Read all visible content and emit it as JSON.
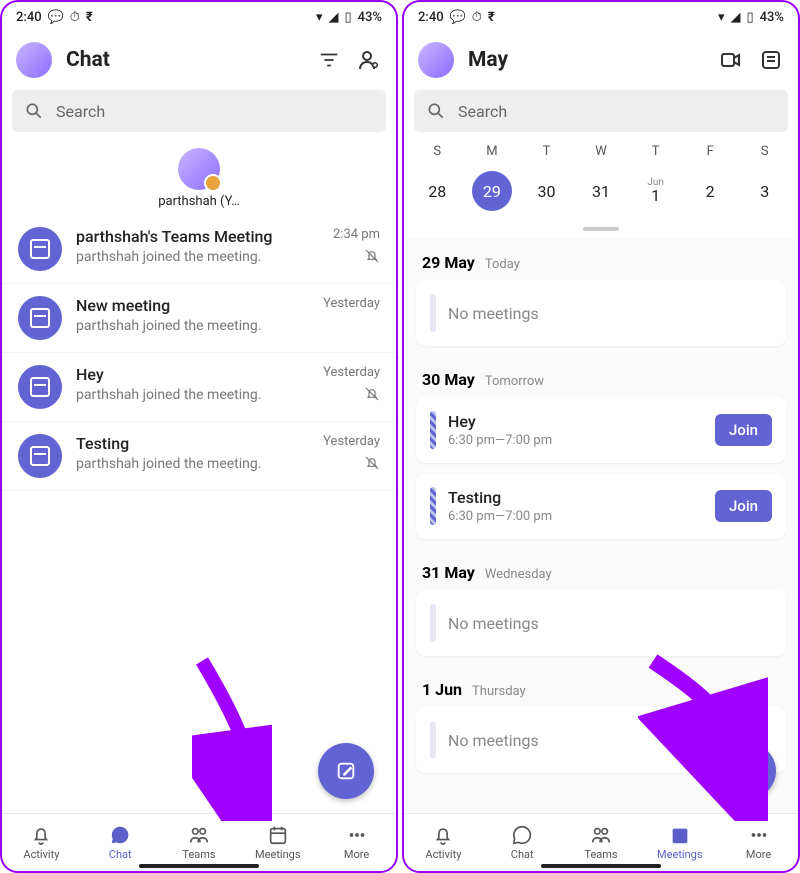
{
  "status": {
    "time": "2:40",
    "battery": "43%"
  },
  "left": {
    "title": "Chat",
    "search": "Search",
    "profile_name": "parthshah (Y…",
    "chats": [
      {
        "title": "parthshah's Teams Meeting",
        "sub": "parthshah joined the meeting.",
        "meta": "2:34 pm",
        "muted": true
      },
      {
        "title": "New meeting",
        "sub": "parthshah joined the meeting.",
        "meta": "Yesterday",
        "muted": false
      },
      {
        "title": "Hey",
        "sub": "parthshah joined the meeting.",
        "meta": "Yesterday",
        "muted": true
      },
      {
        "title": "Testing",
        "sub": "parthshah joined the meeting.",
        "meta": "Yesterday",
        "muted": true
      }
    ],
    "nav": {
      "activity": "Activity",
      "chat": "Chat",
      "teams": "Teams",
      "meetings": "Meetings",
      "more": "More"
    }
  },
  "right": {
    "title": "May",
    "search": "Search",
    "days": [
      "S",
      "M",
      "T",
      "W",
      "T",
      "F",
      "S"
    ],
    "dates": [
      {
        "num": "28"
      },
      {
        "num": "29",
        "selected": true
      },
      {
        "num": "30"
      },
      {
        "num": "31"
      },
      {
        "num": "1",
        "sup": "Jun"
      },
      {
        "num": "2"
      },
      {
        "num": "3"
      }
    ],
    "sections": [
      {
        "date": "29 May",
        "label": "Today",
        "items": [
          {
            "title": "No meetings",
            "empty": true
          }
        ]
      },
      {
        "date": "30 May",
        "label": "Tomorrow",
        "items": [
          {
            "title": "Hey",
            "time": "6:30 pm—7:00 pm",
            "join": "Join"
          },
          {
            "title": "Testing",
            "time": "6:30 pm—7:00 pm",
            "join": "Join"
          }
        ]
      },
      {
        "date": "31 May",
        "label": "Wednesday",
        "items": [
          {
            "title": "No meetings",
            "empty": true
          }
        ]
      },
      {
        "date": "1 Jun",
        "label": "Thursday",
        "items": [
          {
            "title": "No meetings",
            "empty": true
          }
        ]
      }
    ],
    "nav": {
      "activity": "Activity",
      "chat": "Chat",
      "teams": "Teams",
      "meetings": "Meetings",
      "more": "More"
    }
  }
}
